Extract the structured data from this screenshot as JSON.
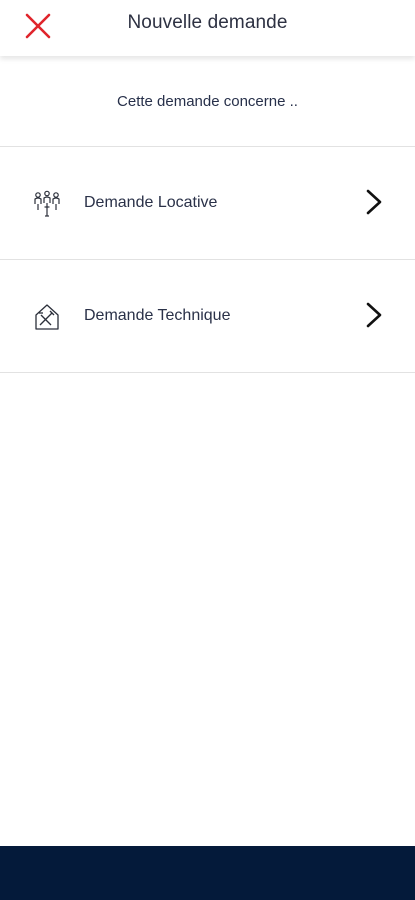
{
  "header": {
    "title": "Nouvelle demande",
    "close_icon": "close-x-icon",
    "close_color": "#e0242b"
  },
  "prompt": {
    "text": "Cette demande concerne .."
  },
  "options": [
    {
      "label": "Demande Locative",
      "icon": "tenant-people-icon"
    },
    {
      "label": "Demande Technique",
      "icon": "house-tools-icon"
    }
  ],
  "colors": {
    "bottom_bar": "#041a3a",
    "text": "#2a3148"
  }
}
